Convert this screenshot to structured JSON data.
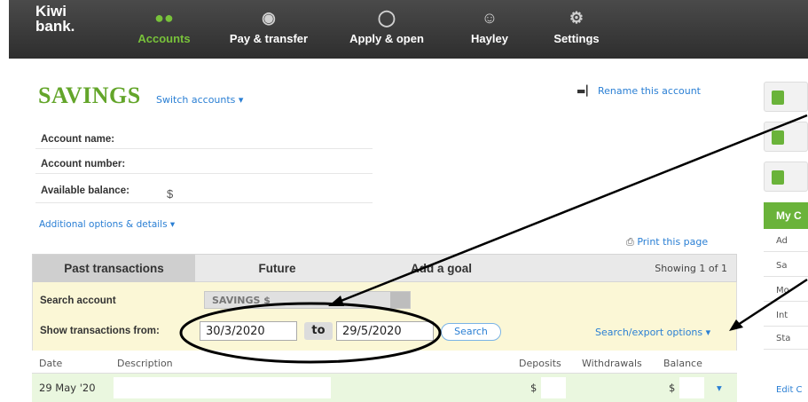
{
  "nav": {
    "logo_line1": "Kiwi",
    "logo_line2": "bank.",
    "items": [
      {
        "label": "Accounts",
        "icon": "accounts-icon",
        "active": true
      },
      {
        "label": "Pay & transfer",
        "icon": "pay-transfer-icon"
      },
      {
        "label": "Apply & open",
        "icon": "apply-open-icon"
      },
      {
        "label": "Hayley",
        "icon": "user-icon"
      },
      {
        "label": "Settings",
        "icon": "settings-icon"
      }
    ]
  },
  "account": {
    "title": "SAVINGS",
    "switch_label": "Switch accounts ▾",
    "rename_label": "Rename this account",
    "fields": [
      {
        "label": "Account name:",
        "value": ""
      },
      {
        "label": "Account number:",
        "value": ""
      },
      {
        "label": "Available balance:",
        "value": "$"
      }
    ],
    "additional_label": "Additional options & details ▾",
    "print_label": "Print this page"
  },
  "tabs": {
    "items": [
      "Past transactions",
      "Future",
      "Add a goal"
    ],
    "showing": "Showing 1 of 1"
  },
  "search": {
    "account_label": "Search account",
    "account_value": "SAVINGS $",
    "from_label": "Show transactions from:",
    "from_date": "30/3/2020",
    "to_label": "to",
    "to_date": "29/5/2020",
    "search_button": "Search",
    "export_label": "Search/export options ▾"
  },
  "table": {
    "headers": [
      "Date",
      "Description",
      "Deposits",
      "Withdrawals",
      "Balance"
    ],
    "rows": [
      {
        "date": "29 May '20",
        "deposit": "$",
        "balance": "$"
      }
    ]
  },
  "sidebar": {
    "panel_title": "My C",
    "items": [
      "Ad",
      "Sa",
      "Mo",
      "Int",
      "Sta"
    ],
    "edit_label": "Edit C"
  },
  "colors": {
    "brand_green": "#63a52a",
    "link_blue": "#2a7fd4",
    "search_bg": "#fbf7d6"
  }
}
